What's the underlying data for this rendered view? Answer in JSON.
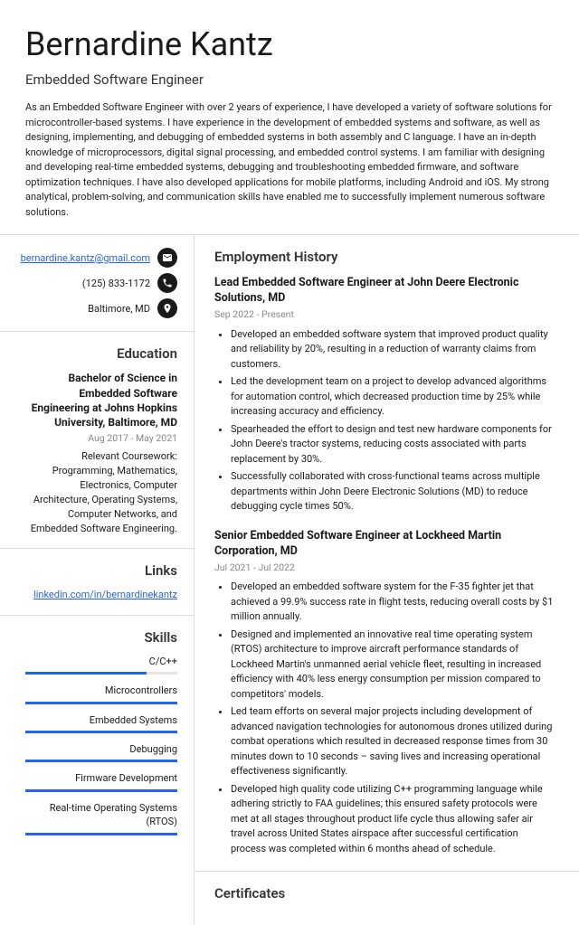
{
  "name": "Bernardine Kantz",
  "title": "Embedded Software Engineer",
  "summary": "As an Embedded Software Engineer with over 2 years of experience, I have developed a variety of software solutions for microcontroller-based systems. I have experience in the development of embedded systems and software, as well as designing, implementing, and debugging of embedded systems in both assembly and C language. I have an in-depth knowledge of microprocessors, digital signal processing, and embedded control systems. I am familiar with designing and developing real-time embedded systems, debugging and troubleshooting embedded firmware, and software optimization techniques. I have also developed applications for mobile platforms, including Android and iOS. My strong analytical, problem-solving, and communication skills have enabled me to successfully implement numerous software solutions.",
  "contact": {
    "email": "bernardine.kantz@gmail.com",
    "phone": "(125) 833-1172",
    "location": "Baltimore, MD"
  },
  "education": {
    "heading": "Education",
    "degree": "Bachelor of Science in Embedded Software Engineering at Johns Hopkins University, Baltimore, MD",
    "dates": "Aug 2017 - May 2021",
    "desc": "Relevant Coursework: Programming, Mathematics, Electronics, Computer Architecture, Operating Systems, Computer Networks, and Embedded Software Engineering."
  },
  "links": {
    "heading": "Links",
    "items": [
      "linkedin.com/in/bernardinekantz"
    ]
  },
  "skills": {
    "heading": "Skills",
    "items": [
      {
        "name": "C/C++",
        "level": 80
      },
      {
        "name": "Microcontrollers",
        "level": 100
      },
      {
        "name": "Embedded Systems",
        "level": 100
      },
      {
        "name": "Debugging",
        "level": 100
      },
      {
        "name": "Firmware Development",
        "level": 100
      },
      {
        "name": "Real-time Operating Systems (RTOS)",
        "level": 100
      }
    ]
  },
  "employment": {
    "heading": "Employment History",
    "jobs": [
      {
        "title": "Lead Embedded Software Engineer at John Deere Electronic Solutions, MD",
        "dates": "Sep 2022 - Present",
        "bullets": [
          "Developed an embedded software system that improved product quality and reliability by 20%, resulting in a reduction of warranty claims from customers.",
          "Led the development team on a project to develop advanced algorithms for automation control, which decreased production time by 25% while increasing accuracy and efficiency.",
          "Spearheaded the effort to design and test new hardware components for John Deere's tractor systems, reducing costs associated with parts replacement by 30%.",
          "Successfully collaborated with cross-functional teams across multiple departments within John Deere Electronic Solutions (MD) to reduce debugging cycle times 50%."
        ]
      },
      {
        "title": "Senior Embedded Software Engineer at Lockheed Martin Corporation, MD",
        "dates": "Jul 2021 - Jul 2022",
        "bullets": [
          "Developed an embedded software system for the F-35 fighter jet that achieved a 99.9% success rate in flight tests, reducing overall costs by $1 million annually.",
          "Designed and implemented an innovative real time operating system (RTOS) architecture to improve aircraft performance standards of Lockheed Martin's unmanned aerial vehicle fleet, resulting in increased efficiency with 40% less energy consumption per mission compared to competitors' models.",
          "Led team efforts on several major projects including development of advanced navigation technologies for autonomous drones utilized during combat operations which resulted in decreased response times from 30 minutes down to 10 seconds – saving lives and increasing operational effectiveness significantly.",
          "Developed high quality code utilizing C++ programming language while adhering strictly to FAA guidelines; this ensured safety protocols were met at all stages throughout product life cycle thus allowing safer air travel across United States airspace after successful certification process was completed within 6 months ahead of schedule."
        ]
      }
    ]
  },
  "certificates": {
    "heading": "Certificates"
  }
}
